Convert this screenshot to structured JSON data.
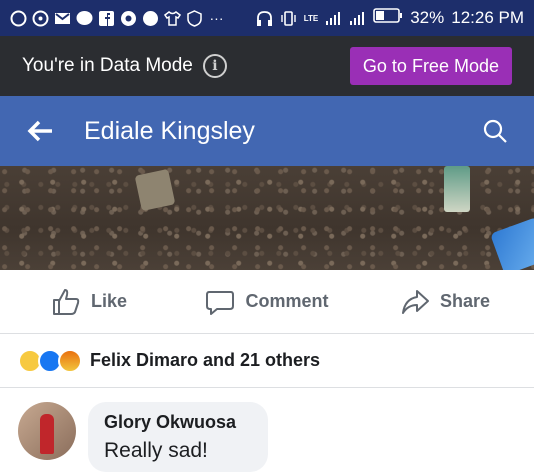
{
  "status_bar": {
    "battery": "32%",
    "time": "12:26 PM",
    "network": "LTE"
  },
  "data_mode": {
    "message": "You're in Data Mode",
    "button": "Go to Free Mode",
    "button_color": "#9a2fb6"
  },
  "header": {
    "title": "Ediale Kingsley",
    "color": "#4267b2"
  },
  "actions": [
    {
      "label": "Like",
      "icon": "thumbs-up-icon"
    },
    {
      "label": "Comment",
      "icon": "comment-icon"
    },
    {
      "label": "Share",
      "icon": "share-icon"
    }
  ],
  "reactions": {
    "icons": [
      "sad-icon",
      "like-icon",
      "angry-icon"
    ],
    "summary": "Felix Dimaro and 21 others"
  },
  "comment": {
    "author": "Glory Okwuosa",
    "text": "Really sad!"
  }
}
